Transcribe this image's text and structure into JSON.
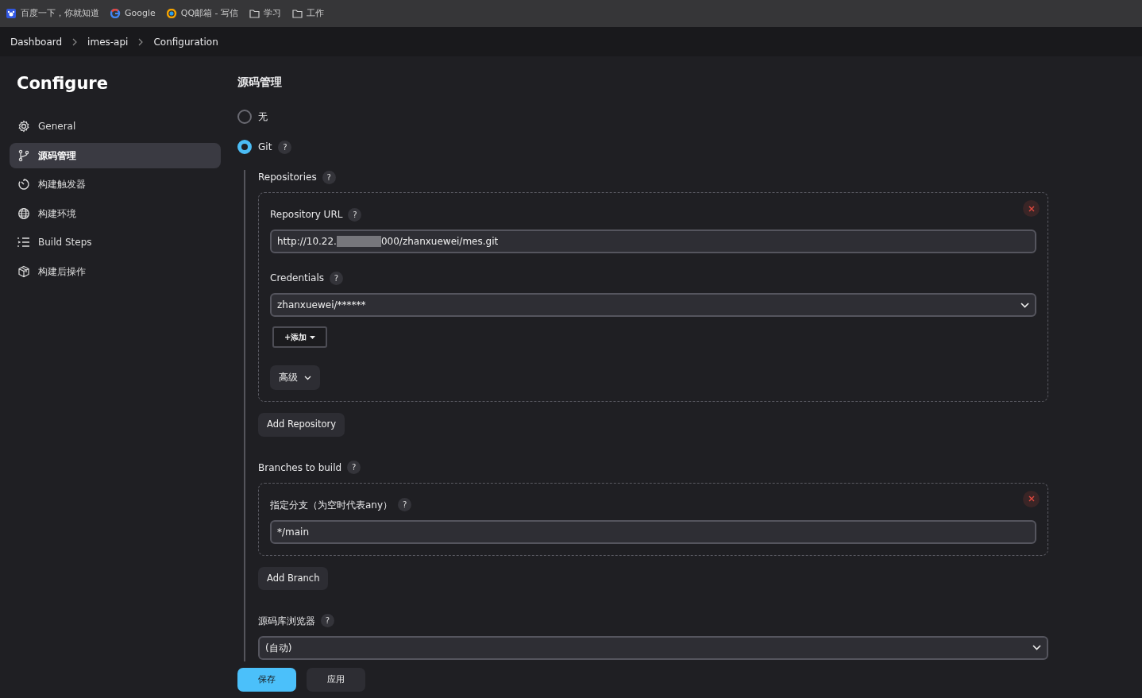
{
  "bookmarks": [
    {
      "label": "百度一下，你就知道",
      "kind": "baidu"
    },
    {
      "label": "Google",
      "kind": "google"
    },
    {
      "label": "QQ邮箱 - 写信",
      "kind": "qqmail"
    },
    {
      "label": "学习",
      "kind": "folder"
    },
    {
      "label": "工作",
      "kind": "folder"
    }
  ],
  "breadcrumbs": [
    "Dashboard",
    "imes-api",
    "Configuration"
  ],
  "sidebar": {
    "title": "Configure",
    "items": [
      {
        "label": "General",
        "selected": false
      },
      {
        "label": "源码管理",
        "selected": true
      },
      {
        "label": "构建触发器",
        "selected": false
      },
      {
        "label": "构建环境",
        "selected": false
      },
      {
        "label": "Build Steps",
        "selected": false
      },
      {
        "label": "构建后操作",
        "selected": false
      }
    ]
  },
  "section": {
    "title": "源码管理",
    "scm_options": [
      {
        "label": "无",
        "selected": false
      },
      {
        "label": "Git",
        "selected": true,
        "help": "?"
      }
    ]
  },
  "repositories": {
    "label": "Repositories",
    "help": "?",
    "items": [
      {
        "url_label": "Repository URL",
        "url_help": "?",
        "url_start": "http://10.22.",
        "url_end": "000/zhanxuewei/mes.git",
        "credentials_label": "Credentials",
        "credentials_help": "?",
        "credentials_value": "zhanxuewei/******",
        "add_button": "+添加",
        "advanced_button": "高级"
      }
    ],
    "add_button": "Add Repository"
  },
  "branches": {
    "label": "Branches to build",
    "help": "?",
    "items": [
      {
        "label": "指定分支（为空时代表any）",
        "help": "?",
        "value": "*/main"
      }
    ],
    "add_button": "Add Branch"
  },
  "browser": {
    "label": "源码库浏览器",
    "help": "?",
    "value": "(自动)"
  },
  "footer": {
    "save": "保存",
    "apply": "应用"
  }
}
